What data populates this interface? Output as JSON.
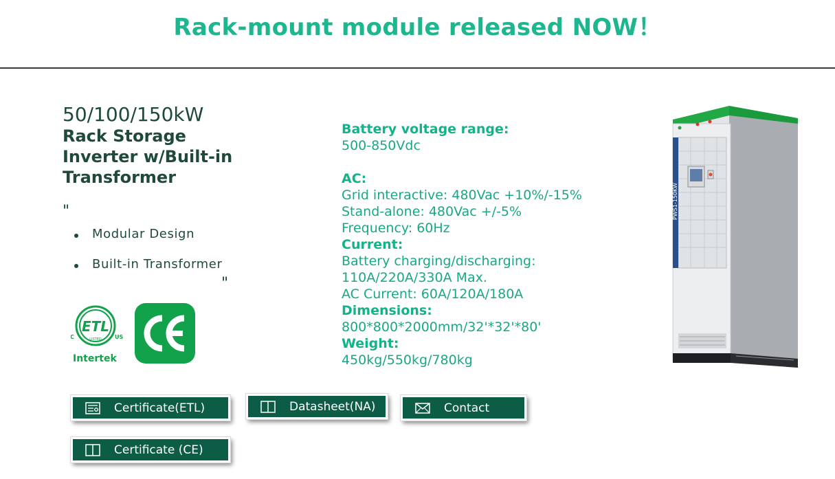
{
  "banner": {
    "title": "Rack-mount module released NOW！"
  },
  "product": {
    "power": "50/100/150kW",
    "name": "Rack Storage Inverter w/Built-in Transformer",
    "quote_open": "\"",
    "quote_close": "\"",
    "features": [
      "Modular Design",
      "Built-in Transformer"
    ]
  },
  "logos": {
    "etl": {
      "c": "C",
      "letters": "ETL",
      "listed": "LISTED",
      "us": "US",
      "brand": "Intertek"
    },
    "ce": {
      "text": "CE"
    }
  },
  "specs": {
    "battery_voltage_label": "Battery voltage range:",
    "battery_voltage_value": "500-850Vdc",
    "ac_label": "AC:",
    "ac_grid": "Grid interactive: 480Vac +10%/-15%",
    "ac_standalone": "Stand-alone: 480Vac +/-5%",
    "ac_frequency": "Frequency: 60Hz",
    "current_label": "Current:",
    "current_battery_1": "Battery charging/discharging:",
    "current_battery_2": "110A/220A/330A Max.",
    "current_ac": "AC Current: 60A/120A/180A",
    "dimensions_label": "Dimensions:",
    "dimensions_value": "800*800*2000mm/32'*32'*80'",
    "weight_label": "Weight:",
    "weight_value": "450kg/550kg/780kg"
  },
  "cabinet": {
    "side_label": "PWS1-150KW"
  },
  "buttons": {
    "etl": "Certificate(ETL)",
    "datasheet": "Datasheet(NA)",
    "contact": "Contact",
    "ce": "Certificate (CE)"
  },
  "colors": {
    "accent": "#1db68f",
    "button": "#0d5c46",
    "heading": "#1f4a3a",
    "ce_green": "#12a24b"
  },
  "icons": {
    "etl_button": "certificate-icon",
    "datasheet_button": "book-icon",
    "contact_button": "envelope-icon",
    "ce_button": "book-icon"
  }
}
